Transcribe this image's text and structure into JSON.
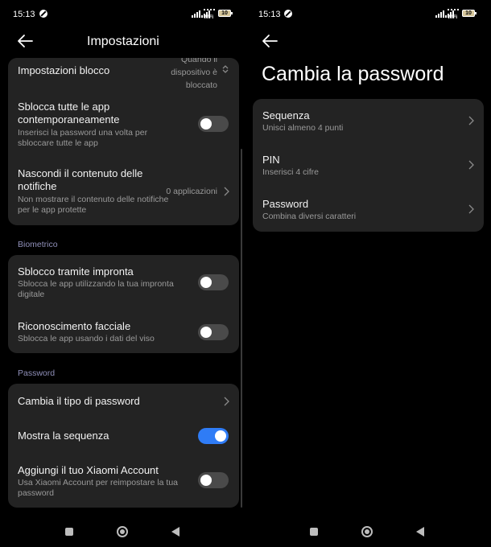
{
  "status_left": {
    "time": "15:13",
    "battery": "10"
  },
  "status_right": {
    "time": "15:13",
    "battery": "10"
  },
  "wifi_label": "WiFi",
  "settings": {
    "header_title": "Impostazioni",
    "lock_settings": {
      "title": "Impostazioni blocco",
      "value": "Quando il dispositivo è bloccato"
    },
    "unlock_all": {
      "title": "Sblocca tutte le app contemporaneamente",
      "subtitle": "Inserisci la password una volta per sbloccare tutte le app",
      "enabled": false
    },
    "hide_content": {
      "title": "Nascondi il contenuto delle notifiche",
      "subtitle": "Non mostrare il contenuto delle notifiche per le app protette",
      "value": "0 applicazioni"
    },
    "biometric_section": "Biometrico",
    "fingerprint": {
      "title": "Sblocco tramite impronta",
      "subtitle": "Sblocca le app utilizzando la tua impronta digitale",
      "enabled": false
    },
    "face": {
      "title": "Riconoscimento facciale",
      "subtitle": "Sblocca le app usando i dati del viso",
      "enabled": false
    },
    "password_section": "Password",
    "change_type": {
      "title": "Cambia il tipo di password"
    },
    "show_pattern": {
      "title": "Mostra la sequenza",
      "enabled": true
    },
    "xiaomi_account": {
      "title": "Aggiungi il tuo Xiaomi Account",
      "subtitle": "Usa Xiaomi Account per reimpostare la tua password",
      "enabled": false
    }
  },
  "change_password": {
    "title": "Cambia la password",
    "options": [
      {
        "title": "Sequenza",
        "subtitle": "Unisci almeno 4 punti"
      },
      {
        "title": "PIN",
        "subtitle": "Inserisci 4 cifre"
      },
      {
        "title": "Password",
        "subtitle": "Combina diversi caratteri"
      }
    ]
  },
  "colors": {
    "accent": "#2f7cf6",
    "card": "#232323",
    "background": "#000000",
    "section_label": "#8f8fb8"
  },
  "icons": {
    "back": "arrow-left-icon",
    "chevron": "chevron-right-icon",
    "updown": "chevron-updown-icon"
  }
}
